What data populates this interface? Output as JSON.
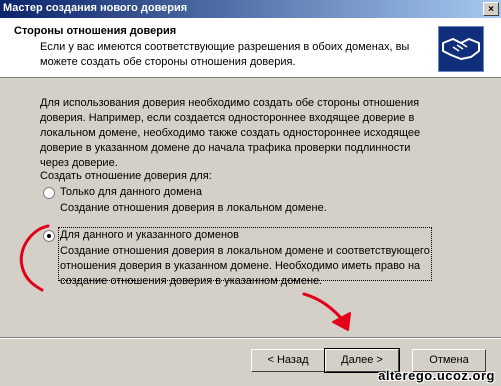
{
  "window": {
    "title": "Мастер создания нового доверия",
    "close_glyph": "×"
  },
  "header": {
    "title": "Стороны отношения доверия",
    "subtitle": "Если у вас имеются соответствующие разрешения в обоих доменах, вы можете создать обе стороны отношения доверия.",
    "icon": "handshake-icon"
  },
  "main": {
    "description": "Для использования доверия необходимо создать обе стороны отношения доверия. Например, если создается одностороннее входящее доверие в локальном домене, необходимо также создать одностороннее исходящее доверие в указанном домене до начала трафика проверки подлинности через доверие.",
    "create_label": "Создать отношение доверия для:",
    "options": [
      {
        "label": "Только для данного домена",
        "description": "Создание отношения доверия в локальном домене.",
        "selected": false
      },
      {
        "label": "Для данного и указанного доменов",
        "description": "Создание отношения доверия в локальном домене и соответствующего отношения доверия в указанном домене. Необходимо иметь право на создание отношения доверия в указанном домене.",
        "selected": true
      }
    ]
  },
  "buttons": {
    "back": "< Назад",
    "next": "Далее >",
    "cancel": "Отмена"
  },
  "watermark": "alterego.ucoz.org",
  "colors": {
    "annotation": "#e3001b",
    "titlebar_start": "#0a246a",
    "titlebar_end": "#a6caf0"
  }
}
